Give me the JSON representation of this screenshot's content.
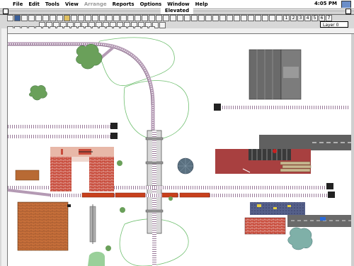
{
  "menubar": {
    "apple_glyph": "",
    "items": [
      "File",
      "Edit",
      "Tools",
      "View",
      "Arrange",
      "Reports",
      "Options",
      "Window",
      "Help"
    ],
    "disabled_item": "Arrange",
    "clock": "4:05 PM"
  },
  "window": {
    "title": "Elevated"
  },
  "layer_select": {
    "value": "Layer 0"
  },
  "toolbar": {
    "number_buttons": [
      "1",
      "2",
      "3",
      "4",
      "5",
      "6",
      "7"
    ]
  }
}
